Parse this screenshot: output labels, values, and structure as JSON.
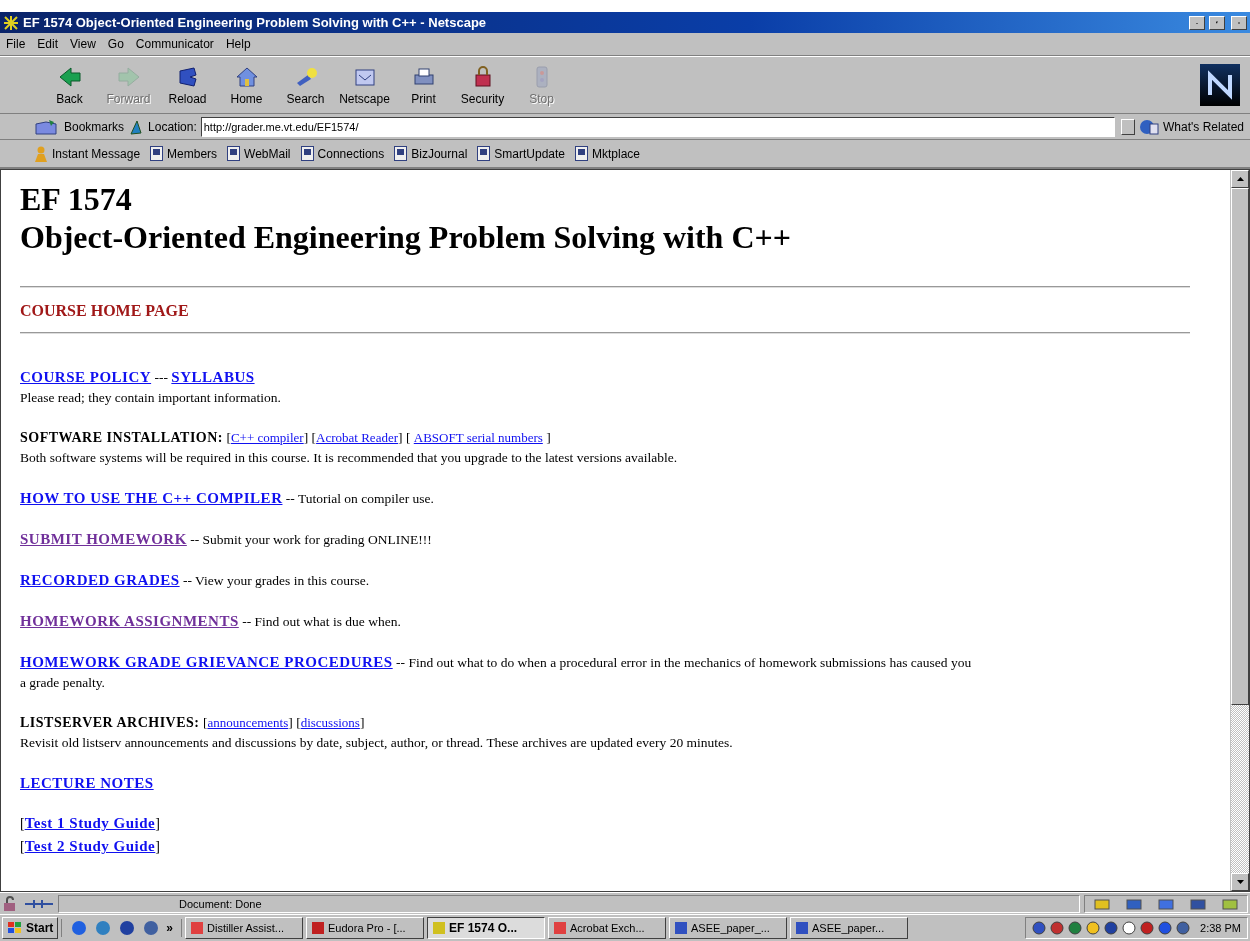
{
  "window": {
    "title": "EF 1574 Object-Oriented Engineering Problem Solving with C++ - Netscape"
  },
  "menu": [
    {
      "label": "File"
    },
    {
      "label": "Edit"
    },
    {
      "label": "View"
    },
    {
      "label": "Go"
    },
    {
      "label": "Communicator"
    },
    {
      "label": "Help"
    }
  ],
  "toolbar": [
    {
      "label": "Back",
      "disabled": false
    },
    {
      "label": "Forward",
      "disabled": true
    },
    {
      "label": "Reload",
      "disabled": false
    },
    {
      "label": "Home",
      "disabled": false
    },
    {
      "label": "Search",
      "disabled": false
    },
    {
      "label": "Netscape",
      "disabled": false
    },
    {
      "label": "Print",
      "disabled": false
    },
    {
      "label": "Security",
      "disabled": false
    },
    {
      "label": "Stop",
      "disabled": true
    }
  ],
  "location_bar": {
    "bookmarks": "Bookmarks",
    "label": "Location:",
    "value": "http://grader.me.vt.edu/EF1574/",
    "related": "What's Related"
  },
  "personal_toolbar": [
    {
      "label": "Instant Message"
    },
    {
      "label": "Members"
    },
    {
      "label": "WebMail"
    },
    {
      "label": "Connections"
    },
    {
      "label": "BizJournal"
    },
    {
      "label": "SmartUpdate"
    },
    {
      "label": "Mktplace"
    }
  ],
  "page": {
    "heading": [
      "EF 1574",
      "Object-Oriented Engineering Problem Solving with C++"
    ],
    "section_title": "COURSE HOME PAGE",
    "entries": [
      {
        "parts": [
          {
            "kind": "link",
            "text": "COURSE POLICY",
            "visited": false
          },
          {
            "kind": "text",
            "text": " --- "
          },
          {
            "kind": "link",
            "text": "SYLLABUS",
            "visited": false
          }
        ],
        "description": "Please read; they contain important information."
      },
      {
        "parts": [
          {
            "kind": "label",
            "text": "SOFTWARE INSTALLATION:"
          },
          {
            "kind": "text",
            "text": " ["
          },
          {
            "kind": "sublink",
            "text": "C++ compiler",
            "visited": false
          },
          {
            "kind": "text",
            "text": "] ["
          },
          {
            "kind": "sublink",
            "text": "Acrobat Reader",
            "visited": false
          },
          {
            "kind": "text",
            "text": "] [ "
          },
          {
            "kind": "sublink",
            "text": "ABSOFT serial numbers",
            "visited": false
          },
          {
            "kind": "text",
            "text": " ]"
          }
        ],
        "description": "Both software systems will be required in this course. It is recommended that you upgrade to the latest versions available."
      },
      {
        "parts": [
          {
            "kind": "link",
            "text": "HOW TO USE THE C++ COMPILER",
            "visited": false
          },
          {
            "kind": "text",
            "text": " -- Tutorial on compiler use."
          }
        ]
      },
      {
        "parts": [
          {
            "kind": "link",
            "text": "SUBMIT HOMEWORK",
            "visited": true
          },
          {
            "kind": "text",
            "text": " -- Submit your work for grading ONLINE!!!"
          }
        ]
      },
      {
        "parts": [
          {
            "kind": "link",
            "text": "RECORDED GRADES",
            "visited": false
          },
          {
            "kind": "text",
            "text": " -- View your grades in this course."
          }
        ]
      },
      {
        "parts": [
          {
            "kind": "link",
            "text": "HOMEWORK ASSIGNMENTS",
            "visited": true
          },
          {
            "kind": "text",
            "text": " -- Find out what is due when."
          }
        ]
      },
      {
        "parts": [
          {
            "kind": "link",
            "text": "HOMEWORK GRADE GRIEVANCE PROCEDURES",
            "visited": false
          },
          {
            "kind": "text",
            "text": " -- Find out what to do when a procedural error in the mechanics of homework submissions has caused you a grade penalty."
          }
        ]
      },
      {
        "parts": [
          {
            "kind": "label",
            "text": "LISTSERVER ARCHIVES:"
          },
          {
            "kind": "text",
            "text": " ["
          },
          {
            "kind": "sublink",
            "text": "announcements",
            "visited": false
          },
          {
            "kind": "text",
            "text": "] ["
          },
          {
            "kind": "sublink",
            "text": "discussions",
            "visited": false
          },
          {
            "kind": "text",
            "text": "]"
          }
        ],
        "description": "Revisit old listserv announcements and discussions by date, subject, author, or thread. These archives are updated every 20 minutes."
      },
      {
        "parts": [
          {
            "kind": "link",
            "text": "LECTURE NOTES",
            "visited": false
          }
        ]
      }
    ],
    "guides": [
      {
        "parts": [
          {
            "kind": "text",
            "text": "["
          },
          {
            "kind": "link",
            "text": "Test 1 Study Guide",
            "visited": false
          },
          {
            "kind": "text",
            "text": "]"
          }
        ]
      },
      {
        "parts": [
          {
            "kind": "text",
            "text": "["
          },
          {
            "kind": "link",
            "text": "Test 2 Study Guide",
            "visited": false
          },
          {
            "kind": "text",
            "text": "]"
          }
        ]
      }
    ]
  },
  "status_bar": {
    "text": "Document: Done"
  },
  "taskbar": {
    "start": "Start",
    "more": "»",
    "tasks": [
      {
        "label": "Distiller Assist...",
        "selected": false
      },
      {
        "label": "Eudora Pro - [...",
        "selected": false
      },
      {
        "label": "EF 1574 O...",
        "selected": true
      },
      {
        "label": "Acrobat Exch...",
        "selected": false
      },
      {
        "label": "ASEE_paper_...",
        "selected": false
      },
      {
        "label": "ASEE_paper...",
        "selected": false
      }
    ],
    "clock": "2:38 PM"
  }
}
